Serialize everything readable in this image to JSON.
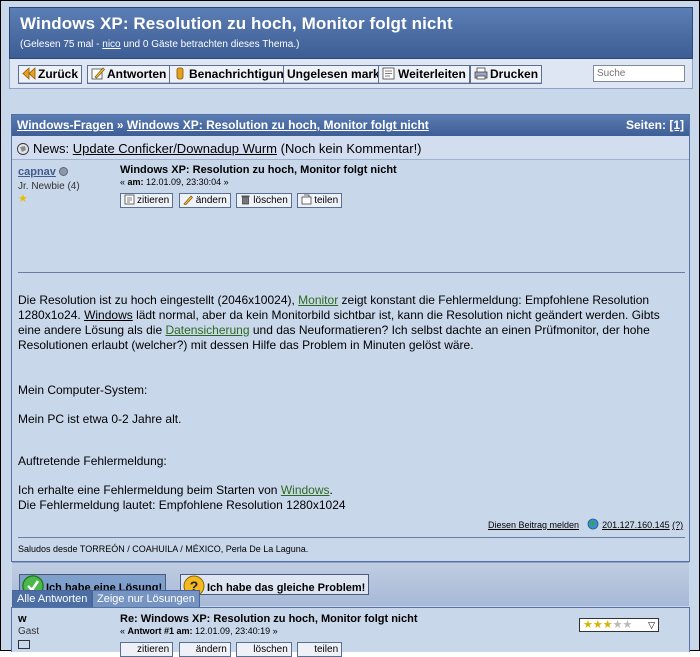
{
  "header": {
    "title": "Windows XP: Resolution zu hoch, Monitor folgt nicht",
    "views_prefix": "(Gelesen 75 mal - ",
    "viewer_user": "nico",
    "views_suffix": " und 0 Gäste betrachten dieses Thema.)"
  },
  "toolbar": {
    "back": "Zurück",
    "reply": "Antworten",
    "notify": "Benachrichtigung",
    "unread": "Ungelesen mark.",
    "forward": "Weiterleiten",
    "print": "Drucken",
    "search_placeholder": "Suche"
  },
  "breadcrumb": {
    "forum": "Windows-Fragen",
    "sep": " » ",
    "topic": "Windows XP: Resolution zu hoch, Monitor folgt nicht",
    "pages_label": "Seiten:",
    "pages_value": "[1]"
  },
  "news": {
    "label": "News:",
    "link": "Update Conficker/Downadup Wurm",
    "comment": "(Noch kein Kommentar!)"
  },
  "post": {
    "author": "capnav",
    "rank": "Jr. Newbie (4)",
    "title": "Windows XP: Resolution zu hoch, Monitor folgt nicht",
    "date_prefix": "« ",
    "date_label": "am:",
    "date_value": " 12.01.09, 23:30:04 »",
    "actions": [
      "zitieren",
      "ändern",
      "löschen",
      "teilen"
    ],
    "body": {
      "p1_a": "Die Resolution ist zu hoch eingestellt (2046x10024), ",
      "p1_link1": "Monitor",
      "p1_b": " zeigt konstant die Fehlermeldung: Empfohlene Resolution 1280x1o24. ",
      "p1_link2": "Windows",
      "p1_c": " lädt normal, aber da kein Monitorbild sichtbar ist, kann die Resolution nicht geändert werden. Gibts eine andere Lösung als die ",
      "p1_link3": "Datensicherung",
      "p1_d": " und das Neuformatieren? Ich selbst dachte an einen Prüfmonitor, der hohe Resolutionen erlaubt (welcher?) mit dessen Hilfe das Problem in Minuten gelöst wäre.",
      "p2": "Mein Computer-System:",
      "p3": "Mein PC ist etwa 0-2 Jahre alt.",
      "p4": "Auftretende Fehlermeldung:",
      "p5_a": "Ich erhalte eine Fehlermeldung beim Starten von ",
      "p5_link": "Windows",
      "p5_b": ".",
      "p6": "Die Fehlermeldung lautet: Empfohlene Resolution 1280x1024"
    },
    "report": "Diesen Beitrag melden",
    "ip": "201.127.160.145",
    "ip_help": "(?)",
    "signature": "Saludos desde TORREÓN / COAHUILA / MÉXICO, Perla De La Laguna."
  },
  "solution_buttons": {
    "have_solution": "Ich habe eine Lösung!",
    "same_problem": "Ich habe das gleiche Problem!"
  },
  "tabs": [
    "Alle Antworten",
    "Zeige nur Lösungen"
  ],
  "answer": {
    "author": "w",
    "rank": "Gast",
    "title": "Re: Windows XP: Resolution zu hoch, Monitor folgt nicht",
    "date_prefix": "« ",
    "date_label": "Antwort #1 am:",
    "date_value": " 12.01.09, 23:40:19 »",
    "rating_stars": 3,
    "rating_max": 5
  },
  "colors": {
    "header_bg": "#4a6ca4",
    "page_bg": "#c9d7ea",
    "link_green": "#2c6a1e"
  }
}
